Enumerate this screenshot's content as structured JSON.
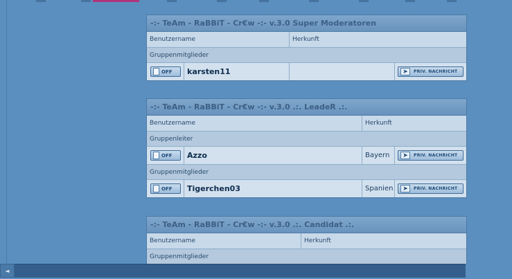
{
  "colors": {
    "accent_tab": "#b0357a",
    "page_bg": "#5b8fbf"
  },
  "groups": [
    {
      "title": "-:- TeAm - RaBBiT - Cr€w -:- v.3.0 Super Moderatoren",
      "col_user": "Benutzername",
      "col_origin": "Herkunft",
      "sections": [
        {
          "label": "Gruppenmitglieder",
          "members": [
            {
              "name": "karsten11",
              "origin": "",
              "status": "OFF",
              "pm": "PRIV. NACHRICHT"
            }
          ]
        }
      ]
    },
    {
      "title": "-:- TeAm - RaBBiT - Cr€w -:- v.3.0 .:. LeadeR .:.",
      "col_user": "Benutzername",
      "col_origin": "Herkunft",
      "sections": [
        {
          "label": "Gruppenleiter",
          "members": [
            {
              "name": "Azzo",
              "origin": "Bayern",
              "status": "OFF",
              "pm": "PRIV. NACHRICHT"
            }
          ]
        },
        {
          "label": "Gruppenmitglieder",
          "members": [
            {
              "name": "Tigerchen03",
              "origin": "Spanien",
              "status": "OFF",
              "pm": "PRIV. NACHRICHT"
            }
          ]
        }
      ]
    },
    {
      "title": "-:- TeAm - RaBBiT - Cr€w -:- v.3.0 .:. Candidat .:.",
      "col_user": "Benutzername",
      "col_origin": "Herkunft",
      "sections": [
        {
          "label": "Gruppenmitglieder",
          "members": []
        }
      ]
    }
  ],
  "scrollbar": {
    "left_arrow": "◄"
  }
}
